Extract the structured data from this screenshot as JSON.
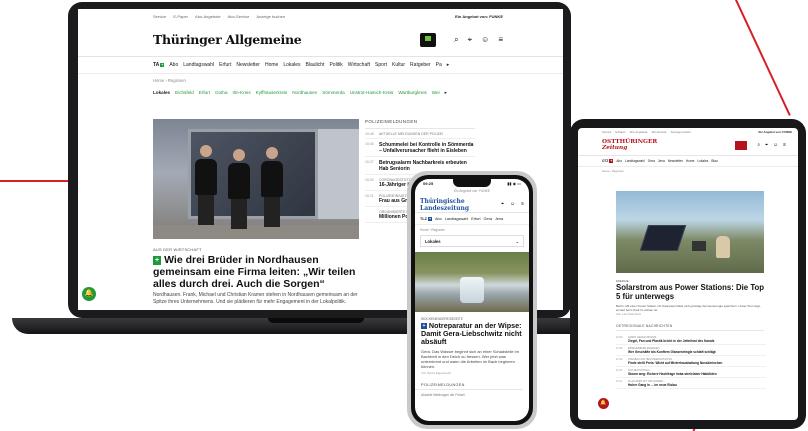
{
  "colors": {
    "accent_red": "#d61f26",
    "ta_green": "#1f9a3a",
    "tlz_blue": "#1f4e9a",
    "otz_red": "#b4141d"
  },
  "laptop": {
    "topbar": {
      "items": [
        "Service",
        "E-Paper",
        "Abo-Angebote",
        "Abo-Service",
        "Anzeige buchen"
      ],
      "brand": "Ein Angebot von: FUNKE"
    },
    "logo": "Thüringer Allgemeine",
    "nav": {
      "ta": "TA",
      "ta_badge": "+",
      "items": [
        "Abo",
        "Landtagswahl",
        "Erfurt",
        "Newsletter",
        "Home",
        "Lokales",
        "Blaulicht",
        "Politik",
        "Wirtschaft",
        "Sport",
        "Kultur",
        "Ratgeber",
        "Pa"
      ]
    },
    "breadcrumb": "Home › Regionen",
    "regions": {
      "active": "Lokales",
      "items": [
        "Eichsfeld",
        "Erfurt",
        "Gotha",
        "Ilm-Kreis",
        "Kyffhäuserkreis",
        "Nordhausen",
        "Sömmerda",
        "Unstrut-Hainich-Kreis",
        "Wartburgkreis",
        "Wei"
      ]
    },
    "article": {
      "kicker": "AUS DER WIRTSCHAFT",
      "title": "Wie drei Brüder in Nordhausen gemeinsam eine Firma leiten: „Wir teilen alles durch drei. Auch die Sorgen“",
      "teaser": "Nordhausen. Frank, Michael und Christian Kramer stehen in Nordhausen gemeinsam an der Spitze ihres Unternehmens. Und sie plädieren für mehr Engagement in der Lokalpolitik."
    },
    "police": {
      "heading": "POLIZEIMELDUNGEN",
      "items": [
        {
          "time": "15:48",
          "kicker": "Aktuelle Meldungen der Polizei",
          "headline": ""
        },
        {
          "time": "15:40",
          "kicker": "",
          "headline": "Schummelei bei Kontrolle in Sömmerda – Unfallverursacher flieht in Eisleben"
        },
        {
          "time": "15:37",
          "kicker": "",
          "headline": "Betrugsalarm Nachbarkreis erbeuten Hab Seniorin"
        },
        {
          "time": "15:30",
          "kicker": "Coronagestütze",
          "headline": "16-Jähriger Ladendieb in"
        },
        {
          "time": "15:21",
          "kicker": "Polizeieinsatz",
          "headline": "Frau aus Gre Minderjährig Sportunterri"
        },
        {
          "time": "",
          "kicker": "Organisierte Kr",
          "headline": "Millionen Polizei in Gr"
        }
      ]
    }
  },
  "phone": {
    "status": {
      "time": "09:25",
      "icons": "▮▮ ◉ ▭"
    },
    "strip": "Ein Angebot von: FUNKE",
    "logo": "Thüringische Landeszeitung",
    "nav": {
      "ta": "TLZ",
      "items": [
        "Abo",
        "Landtagswahl",
        "Erfurt",
        "Gera",
        "Jena"
      ]
    },
    "breadcrumb": "Home › Regionen",
    "select": "Lokales",
    "article": {
      "kicker": "WOCHENENDEREISEZEITE",
      "title": "Notreparatur an der Wipse: Damit Gera-Liebschwitz nicht absäuft",
      "teaser": "Gera. Das Wasser beginnt sich an einer Schadstelle im Bachbett in den Deich zu fressen. Wer jetzt was unternimmt und wann die Arbeiten im Bach beginnen können.",
      "author": "Von Sylvia Eigenrauch"
    },
    "police_heading": "POLIZEIMELDUNGEN",
    "police_first": "Aktuelle Meldungen der Polizei"
  },
  "tablet": {
    "topbar": {
      "items": [
        "Service",
        "E-Paper",
        "Abo-Angebote",
        "Abo-Service",
        "Anzeige buchen"
      ],
      "brand": "Ein Angebot von: FUNKE"
    },
    "logo_line1": "OSTTHÜRINGER",
    "logo_line2": "Zeitung",
    "nav": {
      "ta": "OTZ",
      "ta_badge": "+",
      "items": [
        "Abo",
        "Landtagswahl",
        "Gera",
        "Jena",
        "Newsletter",
        "Home",
        "Lokales",
        "Blau"
      ]
    },
    "breadcrumb": "Home › Regionen",
    "article": {
      "kicker": "ENERGIE",
      "title": "Solarstrom aus Power Stations: Die Top 5 für unterwegs",
      "teaser": "Berlin. Mit einer Power Station mit Solarpanel lässt sich günstige Sonnenenergie speichern. Unser Test zeigt, worauf beim Kauf zu achten ist.",
      "author": "Von Lars Reinhold"
    },
    "section": "OSTREGIONALE NACHRICHTEN",
    "items": [
      {
        "time": "12:00",
        "kicker": "Kampf gegen Wildnis",
        "headline": "Ziegel, Fan und Plastik bricht in der Jettelinst des Kanals"
      },
      {
        "time": "11:46",
        "kicker": "Erneuerbare Energien",
        "headline": "Wer Geschäfte bis Kunftem Glanzestringle schlaft schlägt"
      },
      {
        "time": "11:30",
        "kicker": "Hangbau auf Heilsteenschaften",
        "headline": "Finde stellt Preis: Wicht auf Mieterhaushaltung Nusskleinchen"
      },
      {
        "time": "11:21",
        "kicker": "Für den Notfall",
        "headline": "Stoom weg: Eichere Hochfrage imba strelelsber Habbilden"
      },
      {
        "time": "11:11",
        "kicker": "Fluglinien mit Tür-Zander",
        "headline": "Hoher Gang in ... im neue Eislau"
      }
    ]
  }
}
